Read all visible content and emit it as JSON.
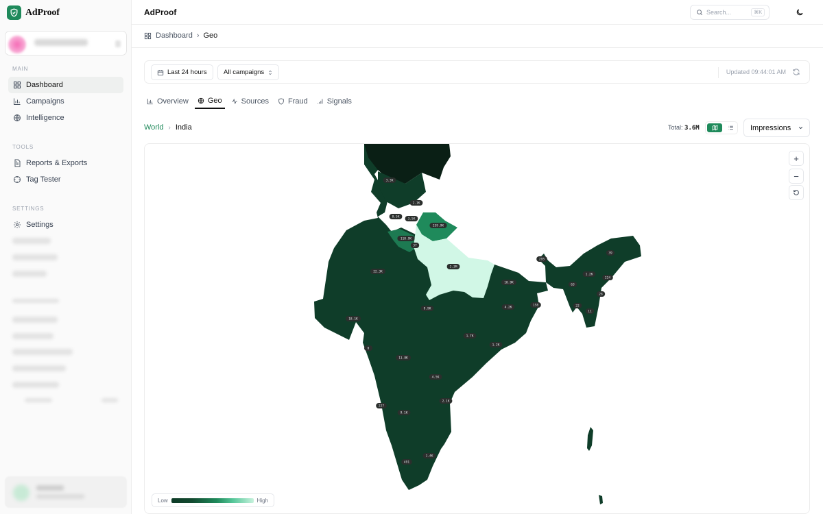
{
  "brand": {
    "name": "AdProof"
  },
  "sidebar": {
    "sections": [
      {
        "label": "MAIN",
        "items": [
          {
            "label": "Dashboard",
            "icon": "grid-icon",
            "active": true
          },
          {
            "label": "Campaigns",
            "icon": "bar-chart-icon"
          },
          {
            "label": "Intelligence",
            "icon": "globe-icon"
          }
        ]
      },
      {
        "label": "TOOLS",
        "items": [
          {
            "label": "Reports & Exports",
            "icon": "document-icon"
          },
          {
            "label": "Tag Tester",
            "icon": "crosshair-icon"
          }
        ]
      },
      {
        "label": "SETTINGS",
        "items": [
          {
            "label": "Settings",
            "icon": "gear-icon"
          }
        ]
      }
    ]
  },
  "header": {
    "title": "AdProof",
    "search_placeholder": "Search...",
    "search_shortcut": "⌘K"
  },
  "breadcrumb": {
    "root": "Dashboard",
    "current": "Geo"
  },
  "filters": {
    "time_range": "Last 24 hours",
    "campaign": "All campaigns",
    "updated": "Updated 09:44:01 AM"
  },
  "tabs": [
    {
      "label": "Overview",
      "icon": "bar-chart-icon"
    },
    {
      "label": "Geo",
      "icon": "globe-icon",
      "active": true
    },
    {
      "label": "Sources",
      "icon": "activity-icon"
    },
    {
      "label": "Fraud",
      "icon": "shield-icon"
    },
    {
      "label": "Signals",
      "icon": "signal-icon"
    }
  ],
  "geo": {
    "crumb_root": "World",
    "crumb_current": "India",
    "total_label": "Total:",
    "total_value": "3.6M",
    "metric": "Impressions"
  },
  "legend": {
    "low": "Low",
    "high": "High"
  },
  "colors": {
    "accent": "#1f8a5b",
    "region_dark": "#0f3d29",
    "region_mid": "#1f8a5b",
    "region_light": "#d1f7e6",
    "region_darkest": "#0a1f15"
  },
  "region_values": [
    {
      "label": "3.3K"
    },
    {
      "label": "2.1K"
    },
    {
      "label": "8.5K"
    },
    {
      "label": "3.5K"
    },
    {
      "label": "259.9K"
    },
    {
      "label": "118.9K"
    },
    {
      "label": "37"
    },
    {
      "label": "2.3M"
    },
    {
      "label": "22.3K"
    },
    {
      "label": "10.9K"
    },
    {
      "label": "4.2K"
    },
    {
      "label": "158"
    },
    {
      "label": "9.9K"
    },
    {
      "label": "18.1K"
    },
    {
      "label": "1.7K"
    },
    {
      "label": "1.2K"
    },
    {
      "label": "0"
    },
    {
      "label": "11.8K"
    },
    {
      "label": "4.5K"
    },
    {
      "label": "2.1K"
    },
    {
      "label": "227"
    },
    {
      "label": "9.1K"
    },
    {
      "label": "1.4K"
    },
    {
      "label": "491"
    },
    {
      "label": "295"
    },
    {
      "label": "39"
    },
    {
      "label": "63"
    },
    {
      "label": "1.2K"
    },
    {
      "label": "224"
    },
    {
      "label": "28"
    },
    {
      "label": "22"
    },
    {
      "label": "11"
    }
  ]
}
